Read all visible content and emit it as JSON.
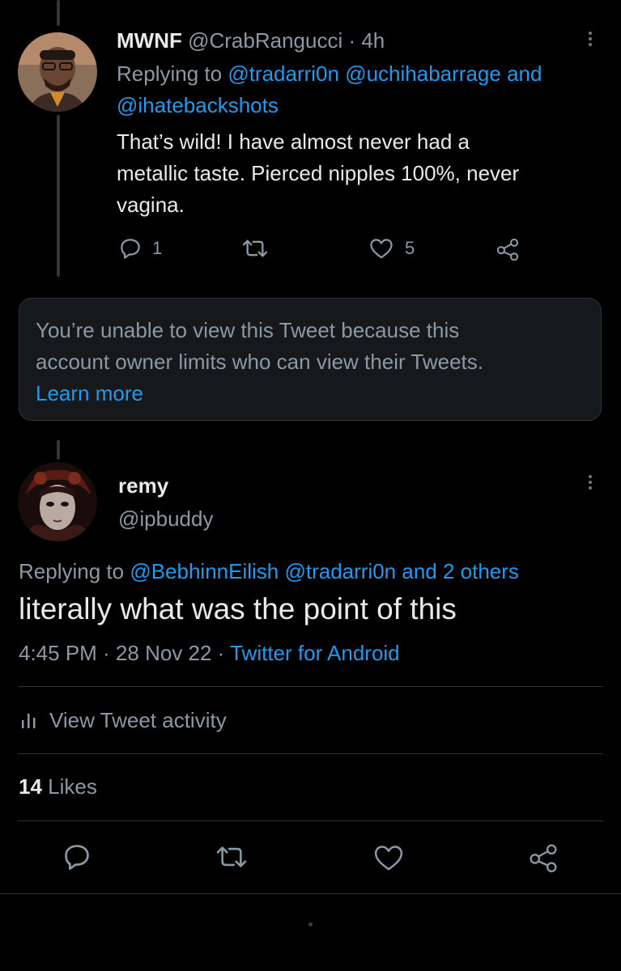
{
  "tweet1": {
    "display_name": "MWNF",
    "handle": "@CrabRangucci",
    "time": "· 4h",
    "replying_prefix": "Replying to",
    "replying_users": "@tradarri0n @uchihabarrage",
    "replying_and": "and",
    "replying_user3": "@ihatebackshots",
    "text_line1": "That’s wild! I have almost never had a",
    "text_line2": "metallic taste. Pierced nipples 100%, never",
    "text_line3": "vagina.",
    "reply_count": "1",
    "like_count": "5"
  },
  "notice": {
    "line1": "You’re unable to view this Tweet because this",
    "line2": "account owner limits who can view their Tweets.",
    "link": "Learn more"
  },
  "tweet2": {
    "display_name": "remy",
    "handle": "@ipbuddy",
    "replying_prefix": "Replying to",
    "replying_users": "@BebhinnEilish @tradarri0n and 2 others",
    "text": "literally what was the point of this",
    "time": "4:45 PM · 28 Nov 22 ·",
    "source": "Twitter for Android",
    "activity": "View Tweet activity",
    "likes_count": "14",
    "likes_label": "Likes"
  },
  "colors": {
    "background": "#000000",
    "text": "#e7e9ea",
    "secondary": "#8b98a5",
    "link": "#1d9bf0"
  },
  "icons": [
    "reply-icon",
    "retweet-icon",
    "like-icon",
    "share-icon",
    "more-icon",
    "activity-icon"
  ]
}
